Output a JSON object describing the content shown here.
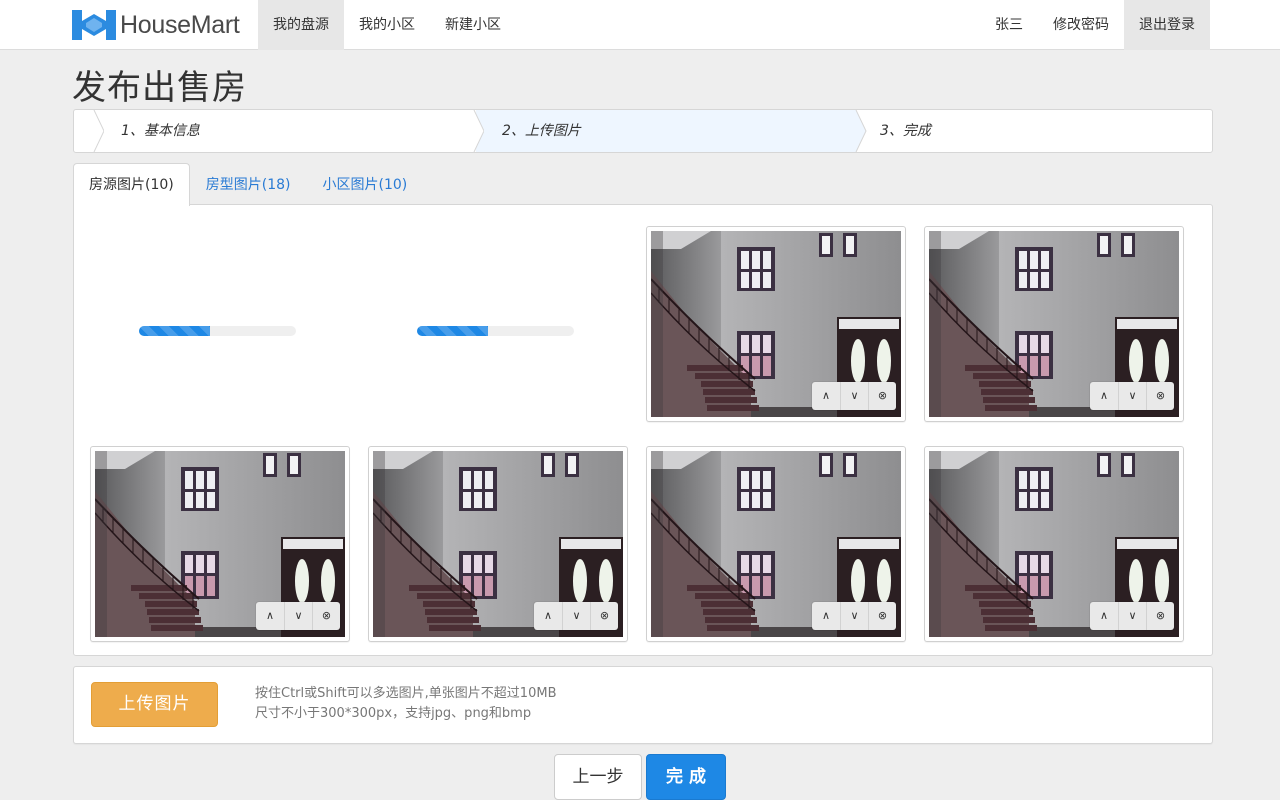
{
  "brand": {
    "name": "HouseMart",
    "logo_icon": "housemart-logo-icon",
    "logo_color": "#2b8be0"
  },
  "nav": {
    "left": [
      {
        "label": "我的盘源",
        "active": true
      },
      {
        "label": "我的小区",
        "active": false
      },
      {
        "label": "新建小区",
        "active": false
      }
    ],
    "right": [
      {
        "label": "张三",
        "active": false
      },
      {
        "label": "修改密码",
        "active": false
      },
      {
        "label": "退出登录",
        "active": true
      }
    ]
  },
  "page": {
    "title": "发布出售房"
  },
  "steps": [
    {
      "label": "1、基本信息",
      "active": false
    },
    {
      "label": "2、上传图片",
      "active": true
    },
    {
      "label": "3、完成",
      "active": false
    }
  ],
  "tabs": [
    {
      "label": "房源图片(10)",
      "active": true
    },
    {
      "label": "房型图片(18)",
      "active": false
    },
    {
      "label": "小区图片(10)",
      "active": false
    }
  ],
  "gallery": {
    "uploading": [
      {
        "progress_percent": 45
      },
      {
        "progress_percent": 45
      }
    ],
    "photo_count": 6,
    "photo_actions": [
      {
        "icon": "move-up-icon",
        "glyph": "∧"
      },
      {
        "icon": "move-down-icon",
        "glyph": "∨"
      },
      {
        "icon": "remove-icon",
        "glyph": "⊗"
      }
    ]
  },
  "upload": {
    "button_label": "上传图片",
    "hint_line1": "按住Ctrl或Shift可以多选图片,单张图片不超过10MB",
    "hint_line2": "尺寸不小于300*300px，支持jpg、png和bmp"
  },
  "actions": {
    "prev_label": "上一步",
    "done_label": "完成"
  },
  "colors": {
    "primary": "#1e88e5",
    "upload": "#eeac4c",
    "active_step": "#eef6ff"
  }
}
